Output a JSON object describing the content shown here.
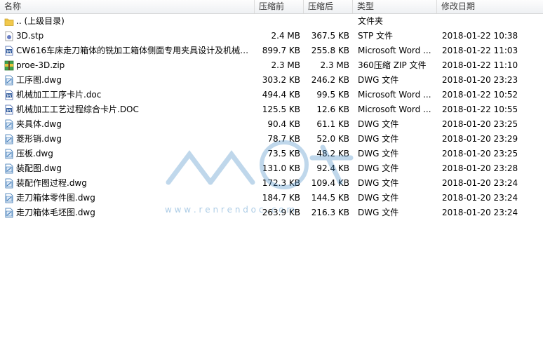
{
  "columns": {
    "name": "名称",
    "compressed": "压缩前",
    "original": "压缩后",
    "type": "类型",
    "modified": "修改日期"
  },
  "rows": [
    {
      "icon": "folder-icon",
      "name": ".. (上级目录)",
      "csize": "",
      "osize": "",
      "type": "文件夹",
      "date": ""
    },
    {
      "icon": "stp-file-icon",
      "name": "3D.stp",
      "csize": "2.4 MB",
      "osize": "367.5 KB",
      "type": "STP 文件",
      "date": "2018-01-22 10:38"
    },
    {
      "icon": "word-file-icon",
      "name": "CW616车床走刀箱体的铣加工箱体侧面专用夹具设计及机械加...",
      "csize": "899.7 KB",
      "osize": "255.8 KB",
      "type": "Microsoft Word ...",
      "date": "2018-01-22 11:03"
    },
    {
      "icon": "zip-file-icon",
      "name": "proe-3D.zip",
      "csize": "2.3 MB",
      "osize": "2.3 MB",
      "type": "360压缩 ZIP 文件",
      "date": "2018-01-22 11:10"
    },
    {
      "icon": "dwg-file-icon",
      "name": "工序图.dwg",
      "csize": "303.2 KB",
      "osize": "246.2 KB",
      "type": "DWG 文件",
      "date": "2018-01-20 23:23"
    },
    {
      "icon": "word-file-icon",
      "name": "机械加工工序卡片.doc",
      "csize": "494.4 KB",
      "osize": "99.5 KB",
      "type": "Microsoft Word ...",
      "date": "2018-01-22 10:52"
    },
    {
      "icon": "word-file-icon",
      "name": "机械加工工艺过程综合卡片.DOC",
      "csize": "125.5 KB",
      "osize": "12.6 KB",
      "type": "Microsoft Word ...",
      "date": "2018-01-22 10:55"
    },
    {
      "icon": "dwg-file-icon",
      "name": "夹具体.dwg",
      "csize": "90.4 KB",
      "osize": "61.1 KB",
      "type": "DWG 文件",
      "date": "2018-01-20 23:25"
    },
    {
      "icon": "dwg-file-icon",
      "name": "菱形销.dwg",
      "csize": "78.7 KB",
      "osize": "52.0 KB",
      "type": "DWG 文件",
      "date": "2018-01-20 23:29"
    },
    {
      "icon": "dwg-file-icon",
      "name": "压板.dwg",
      "csize": "73.5 KB",
      "osize": "48.2 KB",
      "type": "DWG 文件",
      "date": "2018-01-20 23:25"
    },
    {
      "icon": "dwg-file-icon",
      "name": "装配图.dwg",
      "csize": "131.0 KB",
      "osize": "92.4 KB",
      "type": "DWG 文件",
      "date": "2018-01-20 23:28"
    },
    {
      "icon": "dwg-file-icon",
      "name": "装配作图过程.dwg",
      "csize": "172.3 KB",
      "osize": "109.4 KB",
      "type": "DWG 文件",
      "date": "2018-01-20 23:24"
    },
    {
      "icon": "dwg-file-icon",
      "name": "走刀箱体零件图.dwg",
      "csize": "184.7 KB",
      "osize": "144.5 KB",
      "type": "DWG 文件",
      "date": "2018-01-20 23:24"
    },
    {
      "icon": "dwg-file-icon",
      "name": "走刀箱体毛坯图.dwg",
      "csize": "263.9 KB",
      "osize": "216.3 KB",
      "type": "DWG 文件",
      "date": "2018-01-20 23:24"
    }
  ],
  "watermark": {
    "text": "人人文库",
    "url": "w w w . r e n r e n d o c . c o m",
    "color": "#4a90c8"
  }
}
